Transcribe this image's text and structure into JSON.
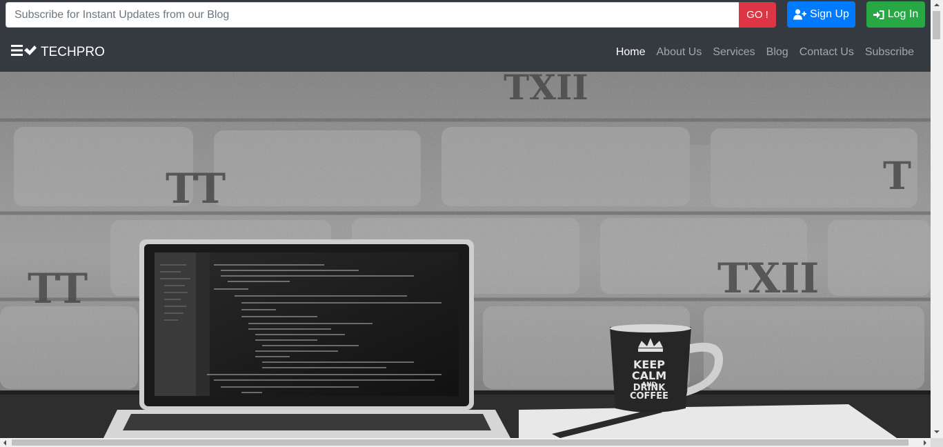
{
  "subscribe": {
    "placeholder": "Subscribe for Instant Updates from our Blog",
    "go_label": "GO !"
  },
  "auth": {
    "signup_label": "Sign Up",
    "login_label": "Log In"
  },
  "brand": {
    "name": "TECHPRO",
    "icon": "menu-check-icon"
  },
  "nav": {
    "items": [
      "Home",
      "About Us",
      "Services",
      "Blog",
      "Contact Us",
      "Subscribe"
    ],
    "active": "Home"
  },
  "hero": {
    "mug_text": [
      "KEEP",
      "CALM",
      "AND",
      "DRINK",
      "COFFEE"
    ]
  },
  "colors": {
    "navbar": "#343a40",
    "go": "#dc3545",
    "signup": "#007bff",
    "login": "#28a745"
  }
}
